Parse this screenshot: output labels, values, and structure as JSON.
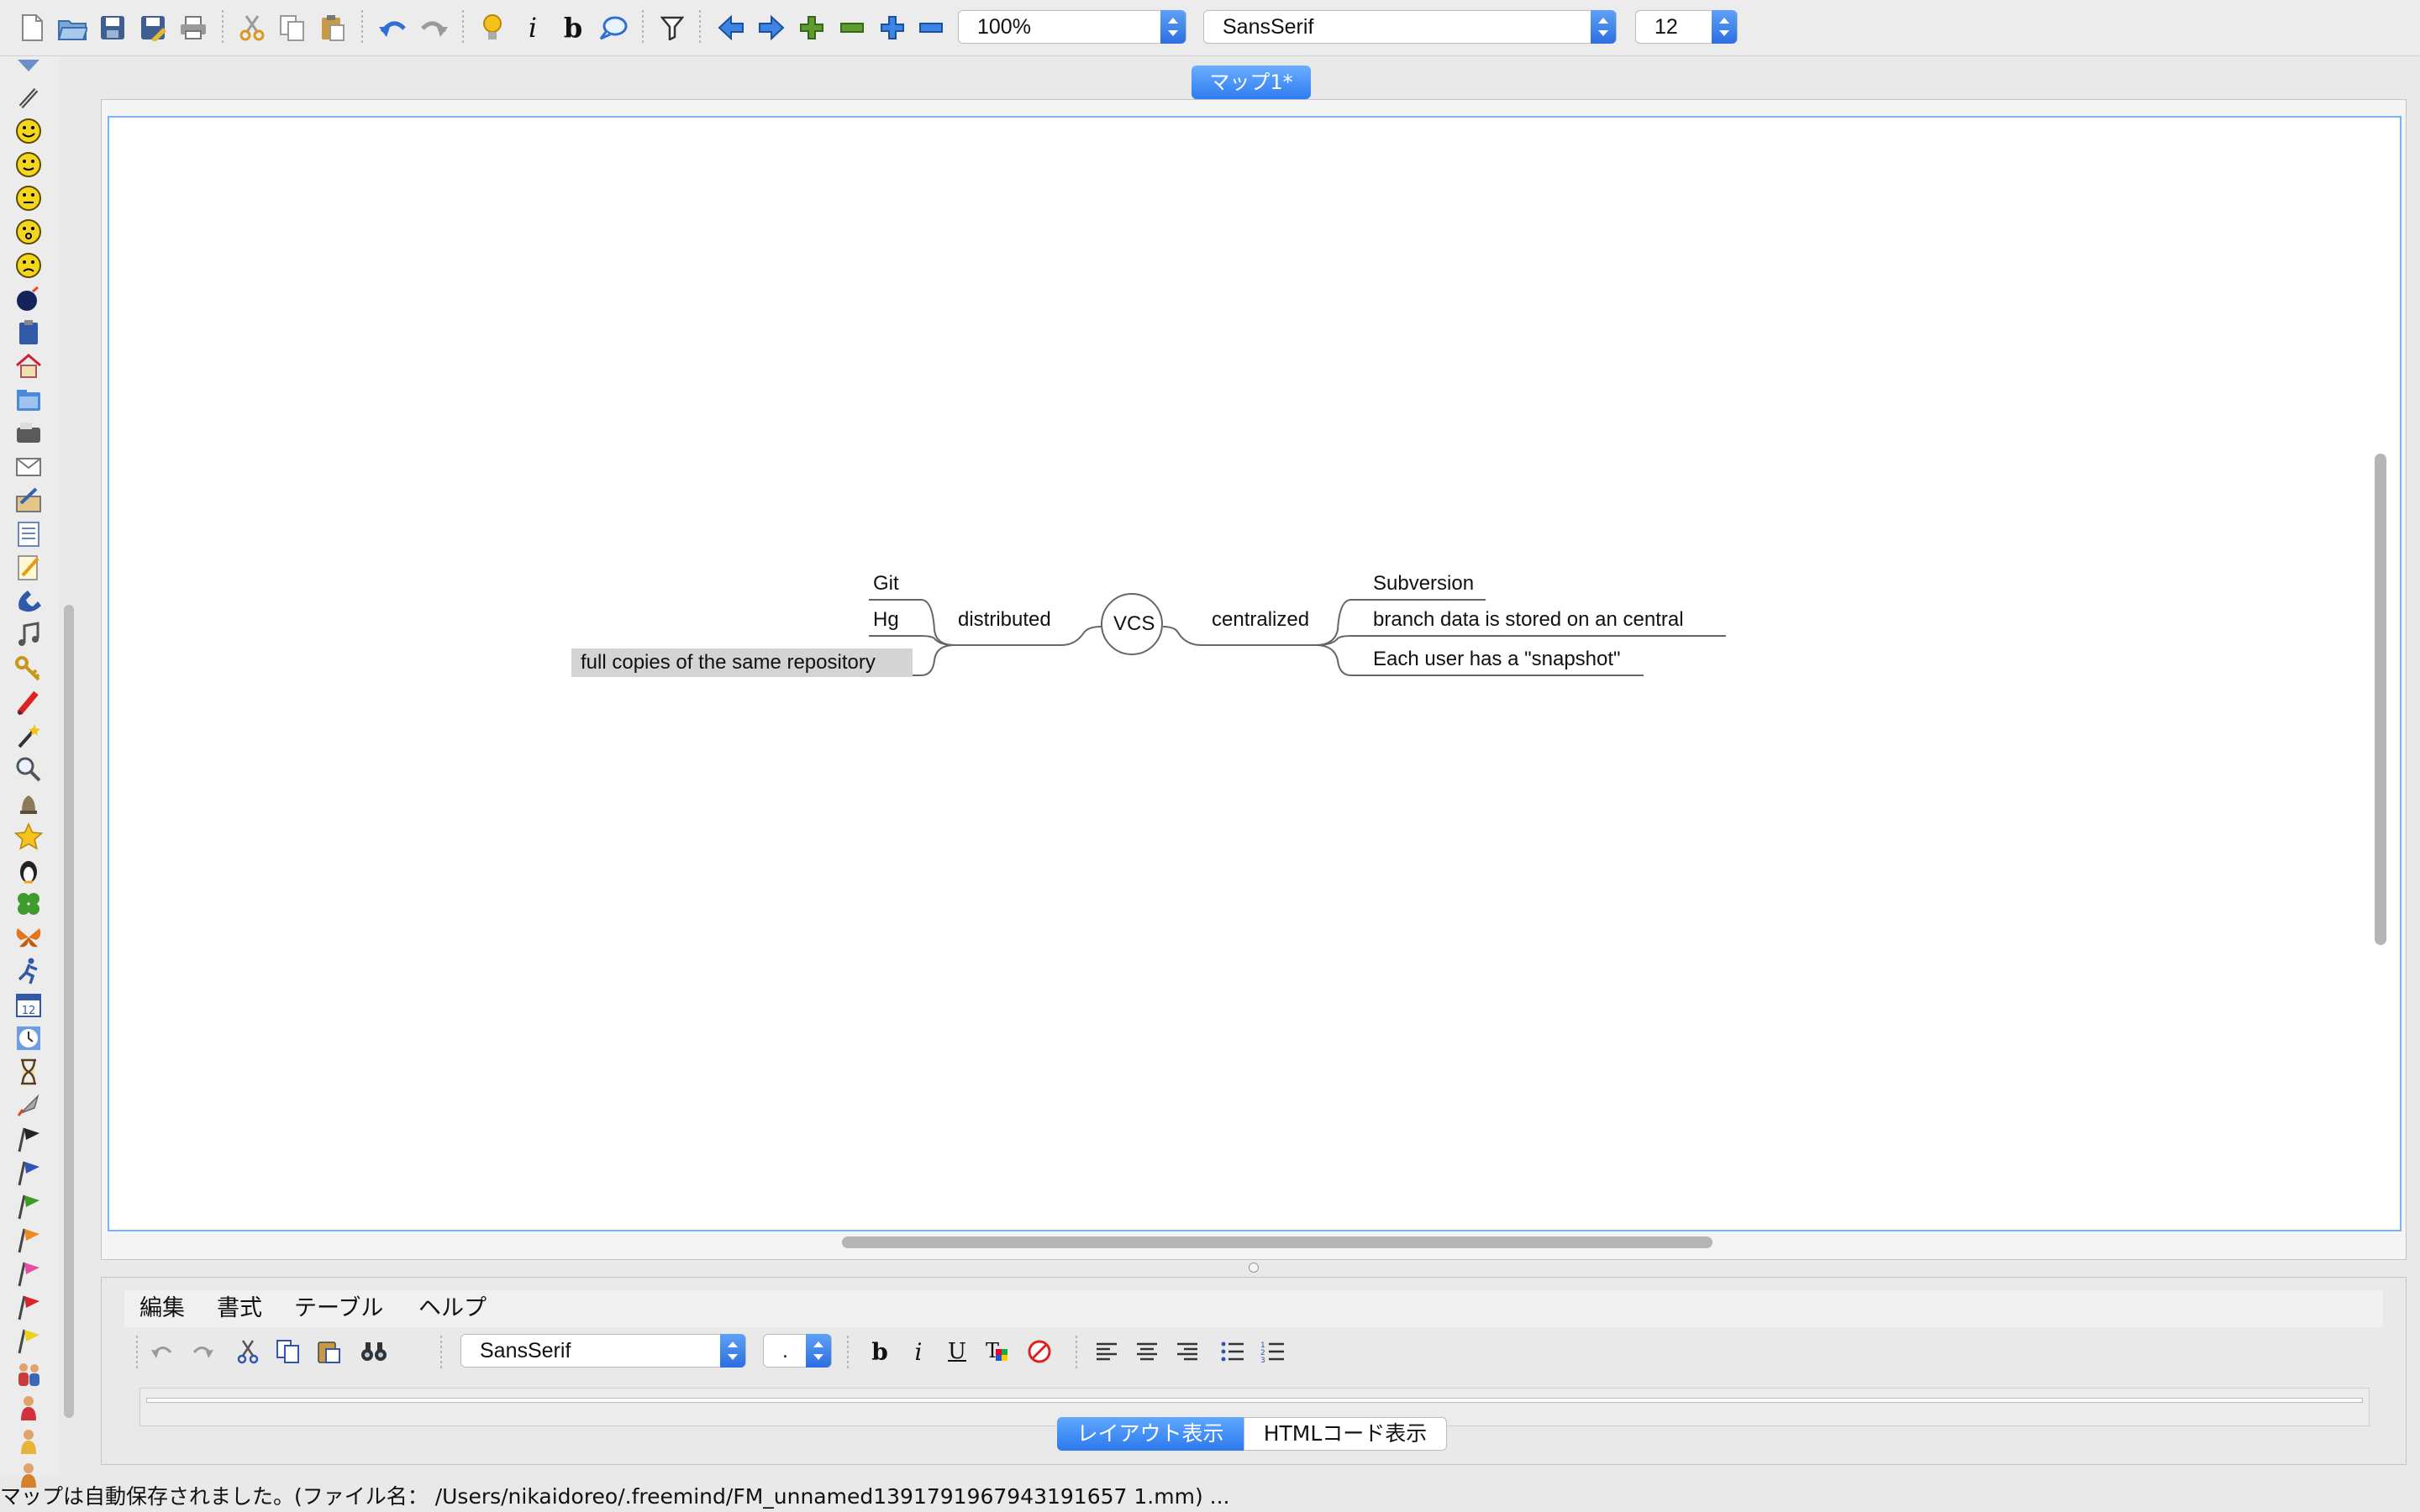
{
  "toolbar": {
    "zoom": "100%",
    "font_family": "SansSerif",
    "font_size": "12",
    "icons": [
      "new-file-icon",
      "open-icon",
      "save-icon",
      "save-as-icon",
      "print-icon",
      "cut-icon",
      "copy-icon",
      "paste-icon",
      "undo-icon",
      "redo-icon",
      "bulb-icon",
      "italic-icon",
      "bold-icon",
      "cloud-icon",
      "filter-icon",
      "back-icon",
      "forward-icon",
      "add-icon",
      "remove-icon",
      "zoom-in-icon",
      "zoom-out-icon"
    ]
  },
  "map_tab": {
    "label": "マップ1*"
  },
  "mindmap": {
    "root": "VCS",
    "left_branch": {
      "label": "distributed",
      "children": [
        "Git",
        "Hg",
        "full copies of the same repository"
      ]
    },
    "right_branch": {
      "label": "centralized",
      "children": [
        "Subversion",
        "branch data is stored on an central",
        "Each user has a \"snapshot\""
      ]
    }
  },
  "editor": {
    "menu": [
      "編集",
      "書式",
      "テーブル",
      "ヘルプ"
    ],
    "font_family": "SansSerif",
    "font_size": ".",
    "tab_layout": "レイアウト表示",
    "tab_html": "HTMLコード表示"
  },
  "status": "マップは自動保存されました。(ファイル名： /Users/nikaidoreo/.freemind/FM_unnamed1391791967943191657 1.mm) ...",
  "colors": {
    "accent": "#2f7cf2",
    "canvas_border": "#7db3ef"
  }
}
